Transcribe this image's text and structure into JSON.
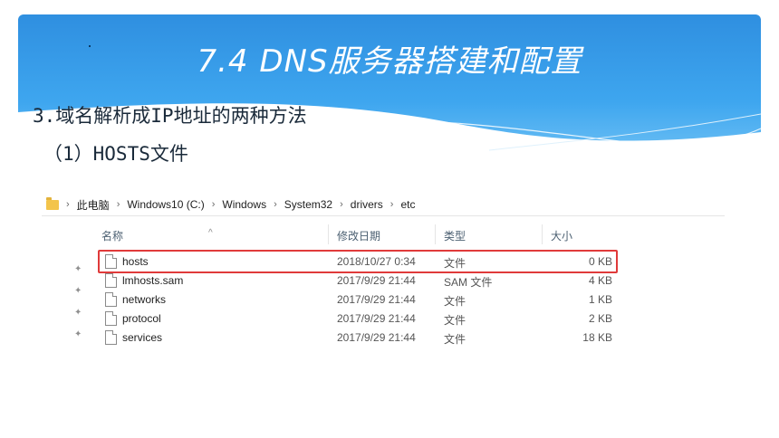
{
  "slide": {
    "title": "7.4 DNS服务器搭建和配置",
    "subtitle": "3.域名解析成IP地址的两种方法",
    "subsection": "（1）HOSTS文件"
  },
  "explorer": {
    "breadcrumb": [
      "此电脑",
      "Windows10 (C:)",
      "Windows",
      "System32",
      "drivers",
      "etc"
    ],
    "columns": {
      "name": "名称",
      "date": "修改日期",
      "type": "类型",
      "size": "大小"
    },
    "files": [
      {
        "name": "hosts",
        "date": "2018/10/27 0:34",
        "type": "文件",
        "size": "0 KB"
      },
      {
        "name": "lmhosts.sam",
        "date": "2017/9/29 21:44",
        "type": "SAM 文件",
        "size": "4 KB"
      },
      {
        "name": "networks",
        "date": "2017/9/29 21:44",
        "type": "文件",
        "size": "1 KB"
      },
      {
        "name": "protocol",
        "date": "2017/9/29 21:44",
        "type": "文件",
        "size": "2 KB"
      },
      {
        "name": "services",
        "date": "2017/9/29 21:44",
        "type": "文件",
        "size": "18 KB"
      }
    ],
    "highlight_color": "#e03a3a",
    "icons": {
      "folder": "folder-icon",
      "pin": "pin-icon",
      "file": "file-icon"
    }
  }
}
